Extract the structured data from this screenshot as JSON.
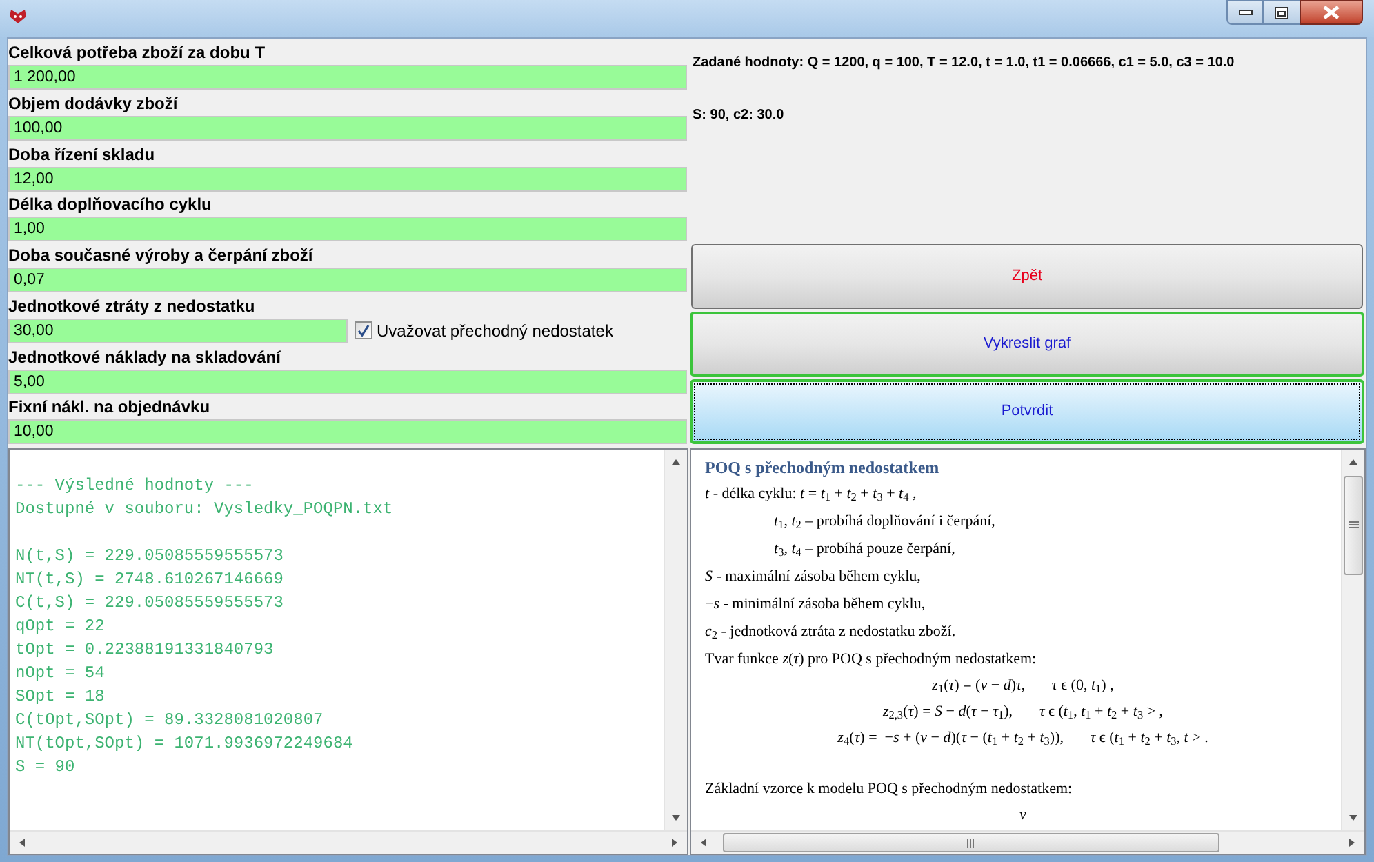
{
  "fields": [
    {
      "label": "Celková potřeba zboží za dobu T",
      "value": "1 200,00"
    },
    {
      "label": "Objem dodávky zboží",
      "value": "100,00"
    },
    {
      "label": "Doba řízení skladu",
      "value": "12,00"
    },
    {
      "label": "Délka doplňovacího cyklu",
      "value": "1,00"
    },
    {
      "label": "Doba současné výroby a čerpání zboží",
      "value": "0,07"
    },
    {
      "label": "Jednotkové ztráty z nedostatku",
      "value": "30,00",
      "checkbox": {
        "label": "Uvažovat přechodný nedostatek",
        "checked": true
      }
    },
    {
      "label": "Jednotkové náklady na skladování",
      "value": "5,00"
    },
    {
      "label": "Fixní nákl. na objednávku",
      "value": "10,00"
    }
  ],
  "info": [
    "Zadané hodnoty: Q = 1200, q = 100, T = 12.0, t = 1.0, t1 = 0.06666, c1 = 5.0, c3 = 10.0",
    "S: 90, c2: 30.0"
  ],
  "buttons": [
    {
      "label": "Zpět",
      "color": "#e8001c",
      "outlined": false,
      "focused": false
    },
    {
      "label": "Vykreslit graf",
      "color": "#1a1ad0",
      "outlined": true,
      "focused": false
    },
    {
      "label": "Potvrdit",
      "color": "#1a1ad0",
      "outlined": true,
      "focused": true
    }
  ],
  "console": {
    "header": [
      "--- Výsledné hodnoty ---",
      "Dostupné v souboru: Vysledky_POQPN.txt"
    ],
    "results": [
      "N(t,S) = 229.05085559555573",
      "NT(t,S) = 2748.610267146669",
      "C(t,S) = 229.05085559555573",
      "qOpt = 22",
      "tOpt = 0.22388191331840793",
      "nOpt = 54",
      "SOpt = 18",
      "C(tOpt,SOpt) = 89.3328081020807",
      "NT(tOpt,SOpt) = 1071.9936972249684",
      "S = 90"
    ]
  },
  "document": [
    {
      "kind": "heading",
      "text": "POQ s přechodným nedostatkem"
    },
    {
      "kind": "text",
      "text": "*t* - délka cyklu: *t* = *t*$_{1}$ + *t*$_{2}$ + *t*$_{3}$ + *t*$_{4}$ ,"
    },
    {
      "kind": "indent",
      "text": "*t*$_{1}$, *t*$_{2}$ – probíhá doplňování i čerpání,"
    },
    {
      "kind": "indent",
      "text": "*t*$_{3}$, *t*$_{4}$ – probíhá pouze čerpání,"
    },
    {
      "kind": "text",
      "text": "*S* - maximální zásoba během cyklu,"
    },
    {
      "kind": "text",
      "text": "−*s* - minimální zásoba během cyklu,"
    },
    {
      "kind": "text",
      "text": "*c*$_{2}$ - jednotková ztráta z nedostatku zboží."
    },
    {
      "kind": "text",
      "text": "Tvar funkce *z*(*τ*) pro POQ s přechodným nedostatkem:"
    },
    {
      "kind": "formula",
      "text": "*z*$_{1}$(*τ*) = (*v* − *d*)*τ*,       *τ* ϵ (0, *t*$_{1}$) ,"
    },
    {
      "kind": "formula",
      "text": "*z*$_{2,3}$(*τ*) = *S* − *d*(*τ* − *τ*$_{1}$),       *τ* ϵ (*t*$_{1}$, *t*$_{1}$ + *t*$_{2}$ + *t*$_{3}$ > ,"
    },
    {
      "kind": "formula",
      "text": "*z*$_{4}$(*τ*) =  −*s* + (*v* − *d*)(*τ* − (*t*$_{1}$ + *t*$_{2}$ + *t*$_{3}$)),       *τ* ϵ (*t*$_{1}$ + *t*$_{2}$ + *t*$_{3}$, *t* > ."
    },
    {
      "kind": "section",
      "text": "Základní vzorce k modelu POQ s přechodným nedostatkem:"
    },
    {
      "kind": "formula",
      "text": "*v*"
    }
  ]
}
